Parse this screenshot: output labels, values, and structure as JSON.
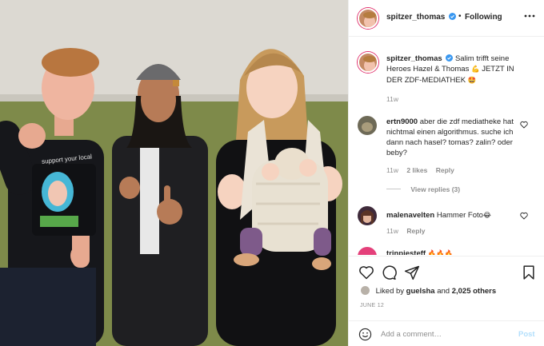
{
  "post": {
    "author": "spitzer_thomas",
    "follow_status": "Following",
    "separator": "•",
    "caption_author": "spitzer_thomas",
    "caption_text": "Salim trifft seine Heroes Hazel & Thomas",
    "caption_emoji_1": "💪",
    "caption_tail": "JETZT IN DER ZDF-MEDIATHEK",
    "caption_emoji_2": "🤩",
    "caption_time": "11w",
    "accent_color": "#0095f6",
    "verified_color": "#3897f0"
  },
  "photo": {
    "shirt_text": "support your local",
    "icons": [
      "person-left",
      "person-middle",
      "person-right",
      "baby-carrier"
    ]
  },
  "comments": [
    {
      "user": "ertn9000",
      "text": "aber die zdf mediatheke hat nichtmal einen algorithmus. suche ich dann nach hasel? tomas? zalin? oder beby?",
      "time": "11w",
      "likes": "2 likes",
      "reply": "Reply",
      "view_replies": "View replies (3)"
    },
    {
      "user": "malenavelten",
      "text": "Hammer Foto",
      "emoji": "😂",
      "time": "11w",
      "reply": "Reply"
    },
    {
      "user": "trinpiesteff",
      "emoji": "🔥🔥🔥"
    }
  ],
  "actions": {
    "liked_by_prefix": "Liked by",
    "liked_by_user": "guelsha",
    "liked_by_and": "and",
    "liked_by_count": "2,025 others",
    "date": "JUNE 12",
    "comment_placeholder": "Add a comment…",
    "post_label": "Post"
  }
}
